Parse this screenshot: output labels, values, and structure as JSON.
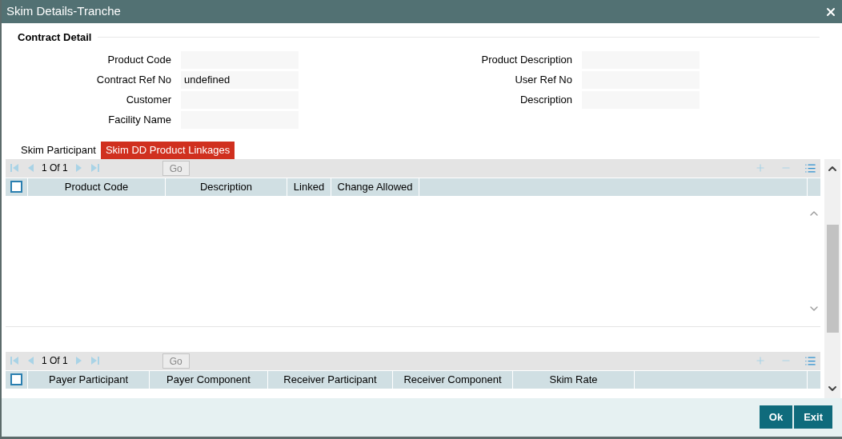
{
  "window": {
    "title": "Skim Details-Tranche"
  },
  "section": {
    "title": "Contract Detail"
  },
  "fields_left": [
    {
      "label": "Product Code"
    },
    {
      "label": "Contract Ref No",
      "value": "undefined"
    },
    {
      "label": "Customer"
    },
    {
      "label": "Facility Name"
    }
  ],
  "fields_right": [
    {
      "label": "Product Description"
    },
    {
      "label": "User Ref No"
    },
    {
      "label": "Description"
    }
  ],
  "tabs": [
    {
      "label": "Skim Participant",
      "selected": false
    },
    {
      "label": "Skim DD Product Linkages",
      "selected": true
    }
  ],
  "grids": [
    {
      "pager": "1 Of 1",
      "go": "Go",
      "header_checked": false,
      "columns": [
        "Product Code",
        "Description",
        "Linked",
        "Change Allowed"
      ]
    },
    {
      "pager": "1 Of 1",
      "go": "Go",
      "header_checked": false,
      "columns": [
        "Payer Participant",
        "Payer Component",
        "Receiver Participant",
        "Receiver Component",
        "Skim Rate"
      ]
    }
  ],
  "buttons": [
    "Ok",
    "Exit"
  ]
}
